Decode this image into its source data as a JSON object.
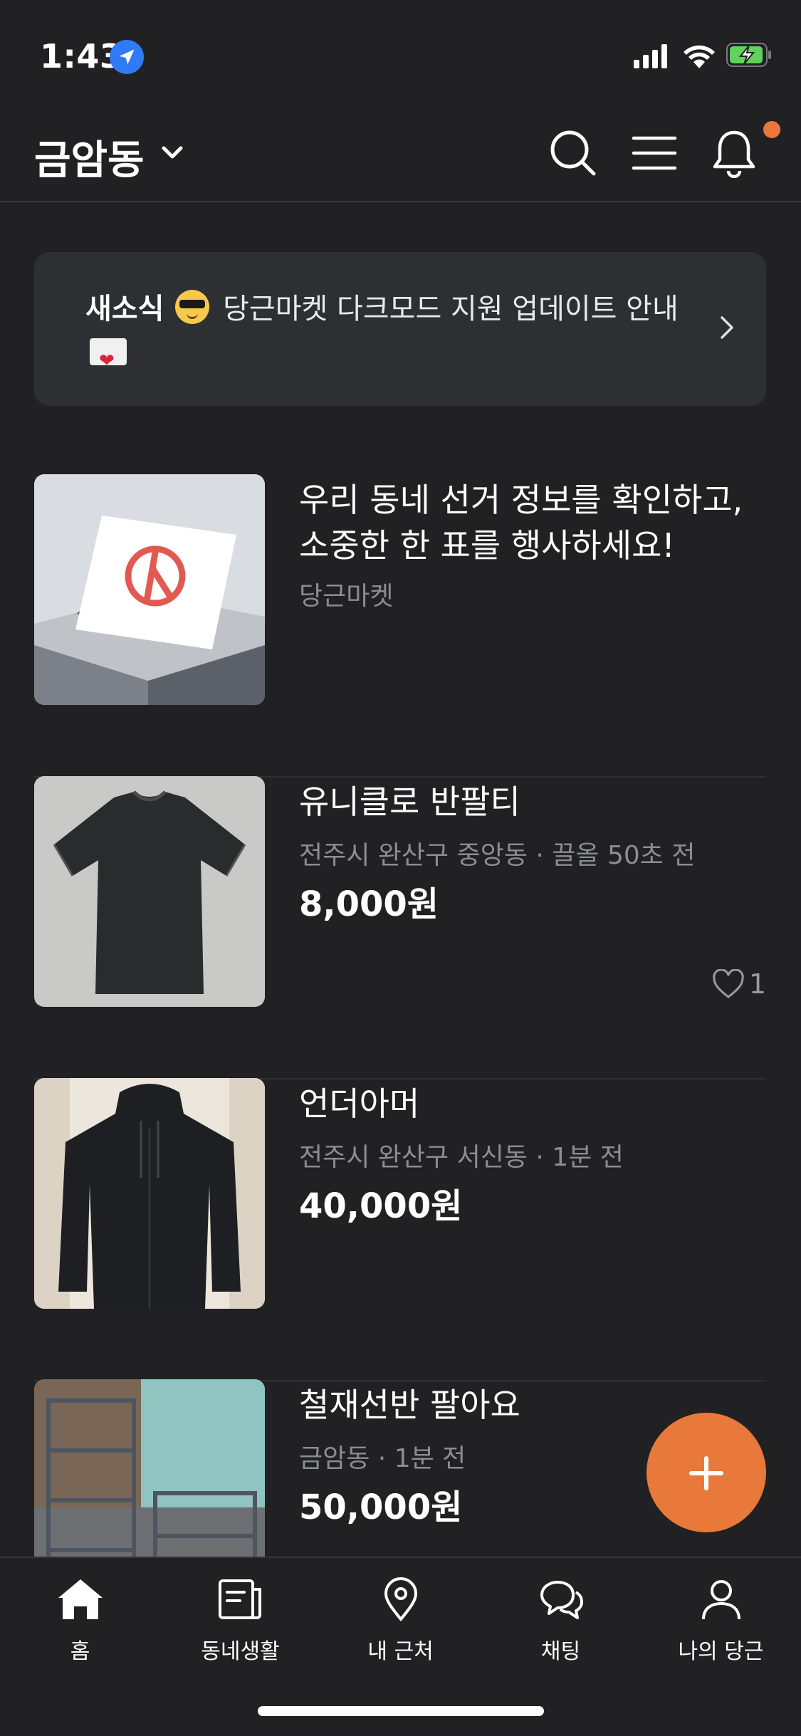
{
  "status_bar": {
    "time": "1:43"
  },
  "header": {
    "location": "금암동"
  },
  "banner": {
    "tag": "새소식",
    "text_part1": "당근마켓 다크모드 지원 업데이트 안내"
  },
  "items": [
    {
      "title": "우리 동네 선거 정보를 확인하고, 소중한 한 표를 행사하세요!",
      "subtitle": "당근마켓",
      "price": ""
    },
    {
      "title": "유니클로 반팔티",
      "subtitle": "전주시 완산구 중앙동 · 끌올 50초 전",
      "price": "8,000원",
      "likes": "1"
    },
    {
      "title": "언더아머",
      "subtitle": "전주시 완산구 서신동 · 1분 전",
      "price": "40,000원"
    },
    {
      "title": "철재선반 팔아요",
      "subtitle": "금암동 · 1분 전",
      "price": "50,000원"
    }
  ],
  "tabbar": {
    "tabs": [
      {
        "label": "홈"
      },
      {
        "label": "동네생활"
      },
      {
        "label": "내 근처"
      },
      {
        "label": "채팅"
      },
      {
        "label": "나의 당근"
      }
    ]
  },
  "colors": {
    "accent": "#e8793a",
    "background": "#212124",
    "subtext": "#8c8d91"
  }
}
